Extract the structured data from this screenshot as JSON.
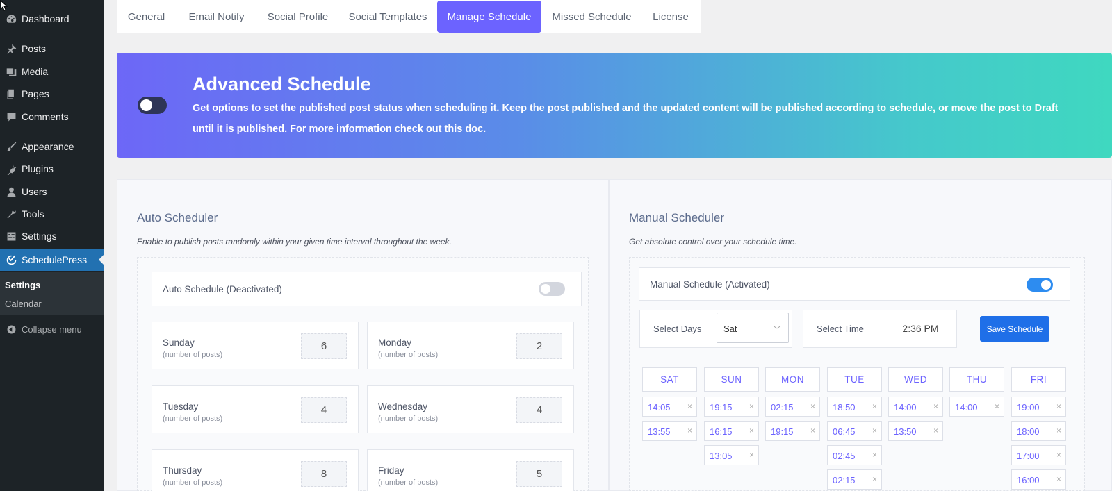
{
  "sidebar": {
    "items": [
      {
        "label": "Dashboard",
        "icon": "dashboard-icon"
      },
      {
        "label": "Posts",
        "icon": "pin-icon"
      },
      {
        "label": "Media",
        "icon": "media-icon"
      },
      {
        "label": "Pages",
        "icon": "pages-icon"
      },
      {
        "label": "Comments",
        "icon": "comments-icon"
      },
      {
        "label": "Appearance",
        "icon": "brush-icon"
      },
      {
        "label": "Plugins",
        "icon": "plug-icon"
      },
      {
        "label": "Users",
        "icon": "user-icon"
      },
      {
        "label": "Tools",
        "icon": "wrench-icon"
      },
      {
        "label": "Settings",
        "icon": "settings-icon"
      },
      {
        "label": "SchedulePress",
        "icon": "schedulepress-icon",
        "active": true
      }
    ],
    "submenu": [
      "Settings",
      "Calendar"
    ],
    "collapse_label": "Collapse menu"
  },
  "tabs": [
    "General",
    "Email Notify",
    "Social Profile",
    "Social Templates",
    "Manage Schedule",
    "Missed Schedule",
    "License"
  ],
  "active_tab": "Manage Schedule",
  "banner": {
    "title": "Advanced Schedule",
    "description": "Get options to set the published post status when scheduling it. Keep the post published and the updated content will be published according to schedule, or move the post to Draft until it is published. For more information check out this doc.",
    "toggle_on": false
  },
  "auto": {
    "title": "Auto Scheduler",
    "description": "Enable to publish posts randomly within your given time interval throughout the week.",
    "toggle_label": "Auto Schedule (Deactivated)",
    "toggle_on": false,
    "days": [
      {
        "name": "Sunday",
        "sub": "(number of posts)",
        "count": "6"
      },
      {
        "name": "Monday",
        "sub": "(number of posts)",
        "count": "2"
      },
      {
        "name": "Tuesday",
        "sub": "(number of posts)",
        "count": "4"
      },
      {
        "name": "Wednesday",
        "sub": "(number of posts)",
        "count": "4"
      },
      {
        "name": "Thursday",
        "sub": "(number of posts)",
        "count": "8"
      },
      {
        "name": "Friday",
        "sub": "(number of posts)",
        "count": "5"
      }
    ]
  },
  "manual": {
    "title": "Manual Scheduler",
    "description": "Get absolute control over your schedule time.",
    "toggle_label": "Manual Schedule (Activated)",
    "toggle_on": true,
    "select_days_label": "Select Days",
    "select_days_value": "Sat",
    "select_time_label": "Select Time",
    "select_time_value": "2:36 PM",
    "save_label": "Save Schedule",
    "remove_glyph": "×",
    "columns": [
      {
        "day": "SAT",
        "slots": [
          "14:05",
          "13:55"
        ]
      },
      {
        "day": "SUN",
        "slots": [
          "19:15",
          "16:15",
          "13:05"
        ]
      },
      {
        "day": "MON",
        "slots": [
          "02:15",
          "19:15"
        ]
      },
      {
        "day": "TUE",
        "slots": [
          "18:50",
          "06:45",
          "02:45",
          "02:15"
        ]
      },
      {
        "day": "WED",
        "slots": [
          "14:00",
          "13:50"
        ]
      },
      {
        "day": "THU",
        "slots": [
          "14:00"
        ]
      },
      {
        "day": "FRI",
        "slots": [
          "19:00",
          "18:00",
          "17:00",
          "16:00"
        ]
      }
    ]
  },
  "colors": {
    "accent": "#6c63ff",
    "wp_active": "#2271b1",
    "sidebar_bg": "#1d2327",
    "toggle_on": "#2d8cf0",
    "save_button": "#1f6fe8"
  }
}
